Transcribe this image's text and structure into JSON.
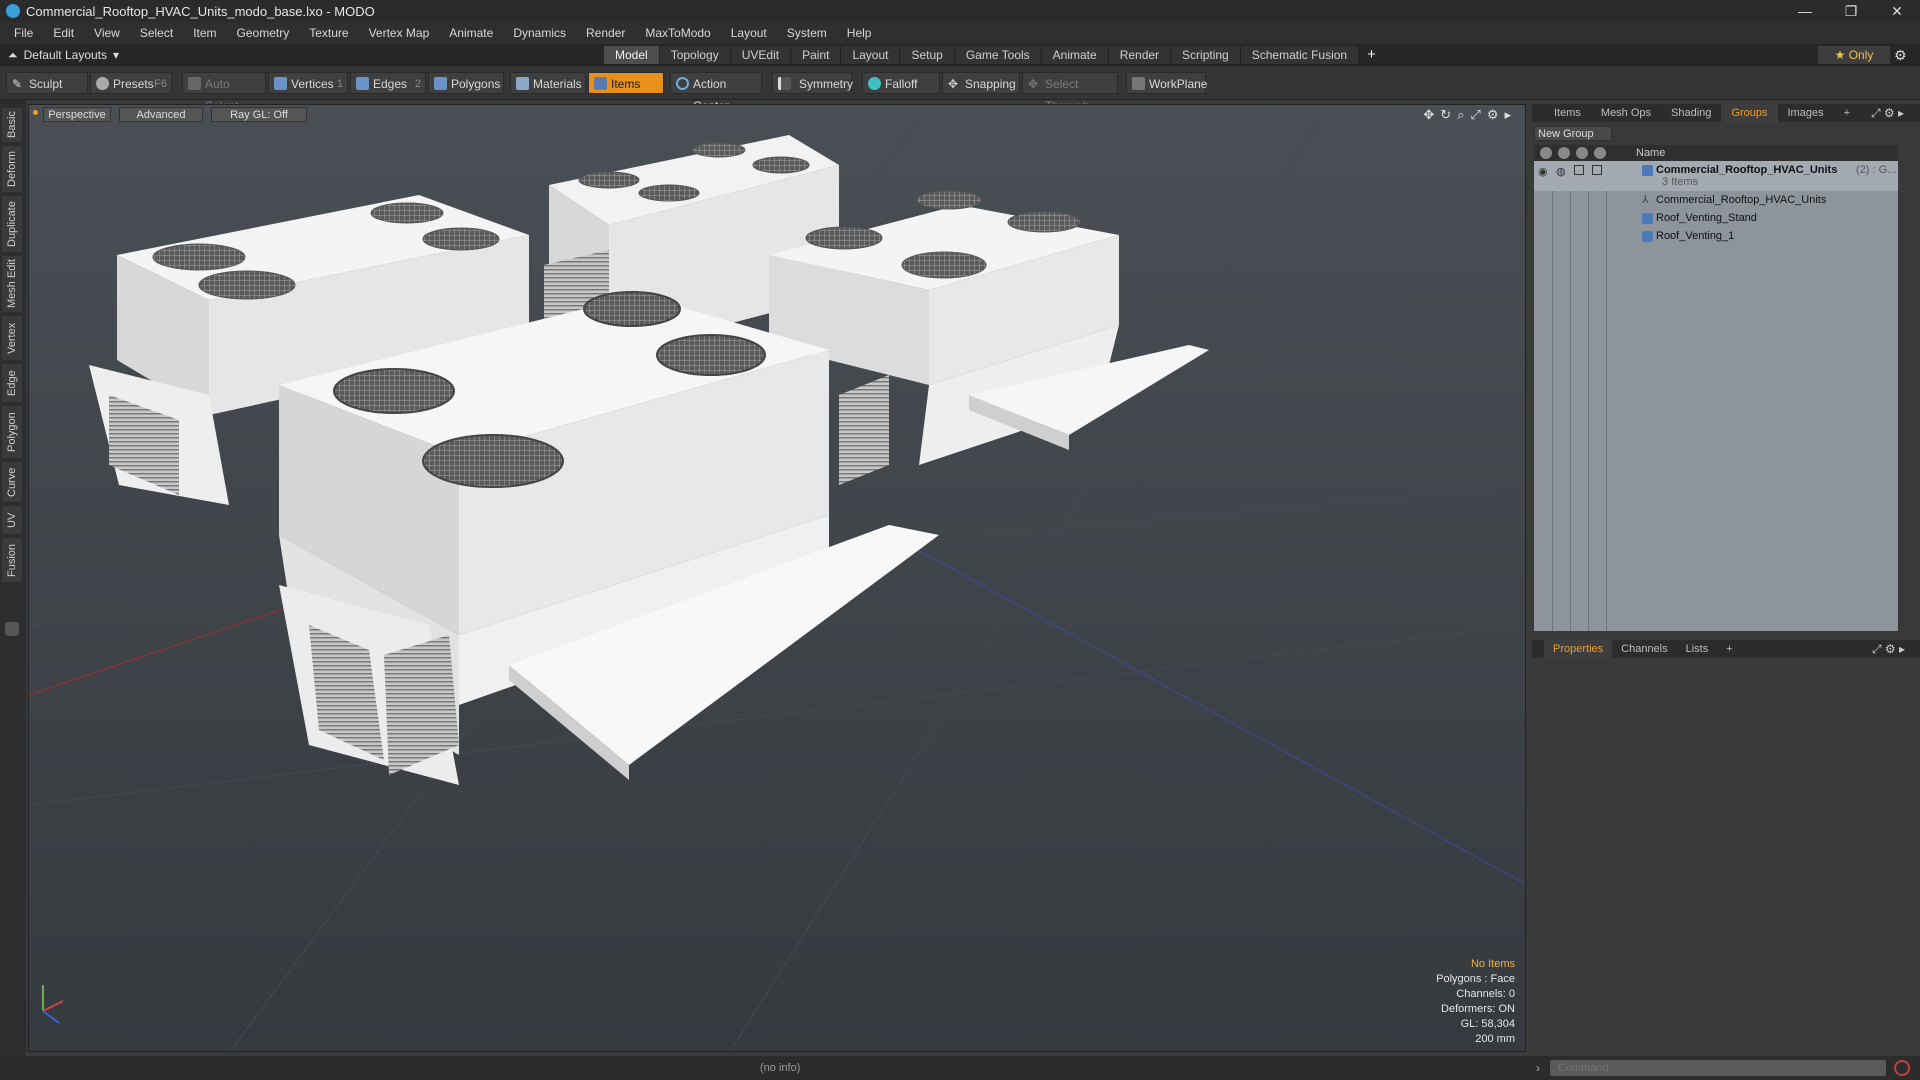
{
  "window": {
    "title": "Commercial_Rooftop_HVAC_Units_modo_base.lxo - MODO",
    "controls": [
      "—",
      "❐",
      "✕"
    ]
  },
  "menu": [
    "File",
    "Edit",
    "View",
    "Select",
    "Item",
    "Geometry",
    "Texture",
    "Vertex Map",
    "Animate",
    "Dynamics",
    "Render",
    "MaxToModo",
    "Layout",
    "System",
    "Help"
  ],
  "layout_bar": {
    "layouts_label": "Default Layouts",
    "tabs": [
      "Model",
      "Topology",
      "UVEdit",
      "Paint",
      "Layout",
      "Setup",
      "Game Tools",
      "Animate",
      "Render",
      "Scripting",
      "Schematic Fusion"
    ],
    "active_tab": "Model",
    "only_label": "Only"
  },
  "toolbar": {
    "sculpt": "Sculpt",
    "presets": "Presets",
    "presets_key": "F6",
    "auto_select": "Auto Select",
    "vertices": "Vertices",
    "vertices_count": "1",
    "edges": "Edges",
    "edges_count": "2",
    "polygons": "Polygons",
    "materials": "Materials",
    "items": "Items",
    "action_center": "Action Center",
    "symmetry": "Symmetry",
    "falloff": "Falloff",
    "snapping": "Snapping",
    "select_through": "Select Through",
    "workplane": "WorkPlane"
  },
  "left_tabs": [
    "Basic",
    "Deform",
    "Duplicate",
    "Mesh Edit",
    "Vertex",
    "Edge",
    "Polygon",
    "Curve",
    "UV",
    "Fusion"
  ],
  "viewport": {
    "perspective": "Perspective",
    "advanced": "Advanced",
    "raygl": "Ray GL: Off",
    "info": {
      "no_items": "No Items",
      "polygons": "Polygons : Face",
      "channels": "Channels: 0",
      "deformers": "Deformers: ON",
      "gl": "GL: 58,304",
      "scale": "200 mm"
    }
  },
  "items_panel": {
    "tabs": [
      "Items",
      "Mesh Ops",
      "Shading",
      "Groups",
      "Images"
    ],
    "active_tab": "Groups",
    "new_group": "New Group",
    "name_header": "Name",
    "group_name": "Commercial_Rooftop_HVAC_Units",
    "group_count": "(2) : G...",
    "items_count": "3 Items",
    "children": [
      "Commercial_Rooftop_HVAC_Units",
      "Roof_Venting_Stand",
      "Roof_Venting_1"
    ]
  },
  "properties_panel": {
    "tabs": [
      "Properties",
      "Channels",
      "Lists"
    ],
    "active_tab": "Properties"
  },
  "status": {
    "info": "(no info)",
    "command_placeholder": "Command"
  }
}
